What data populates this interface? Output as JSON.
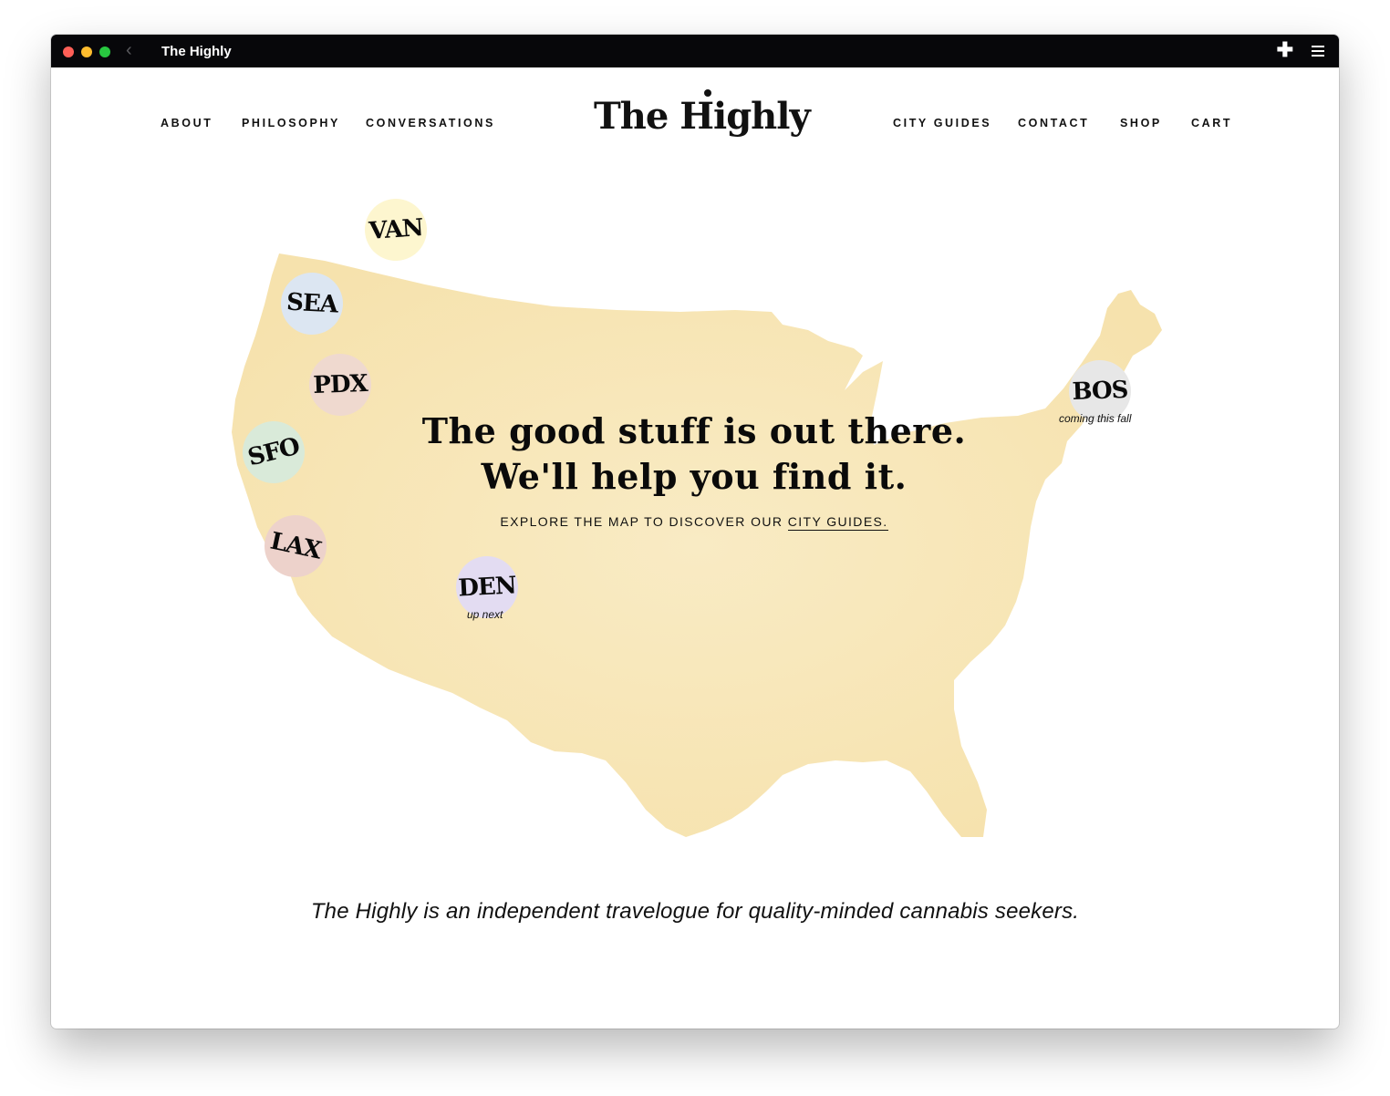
{
  "window": {
    "title": "The Highly",
    "back_icon": "chevron-left-icon",
    "new_tab_icon": "plus-icon",
    "menu_icon": "hamburger-icon"
  },
  "nav": {
    "left": [
      "ABOUT",
      "PHILOSOPHY",
      "CONVERSATIONS"
    ],
    "right": [
      "CITY GUIDES",
      "CONTACT",
      "SHOP",
      "CART"
    ]
  },
  "logo": "The Highly",
  "map": {
    "fill_color": "#f7e6b8",
    "cities": [
      {
        "code": "VAN",
        "color": "#fdf6cf",
        "note": ""
      },
      {
        "code": "SEA",
        "color": "#dce6f2",
        "note": ""
      },
      {
        "code": "PDX",
        "color": "#efd9cf",
        "note": ""
      },
      {
        "code": "SFO",
        "color": "#d9ead9",
        "note": ""
      },
      {
        "code": "LAX",
        "color": "#edd2cb",
        "note": ""
      },
      {
        "code": "DEN",
        "color": "#e3dcf2",
        "note": "up next"
      },
      {
        "code": "BOS",
        "color": "#e7e7e7",
        "note": "coming this fall"
      }
    ]
  },
  "hero": {
    "line1": "The good stuff is out there.",
    "line2": "We'll help you find it.",
    "explore_prefix": "EXPLORE THE MAP TO DISCOVER OUR",
    "explore_link": "CITY GUIDES."
  },
  "tagline": "The Highly is an independent travelogue for quality-minded cannabis seekers."
}
